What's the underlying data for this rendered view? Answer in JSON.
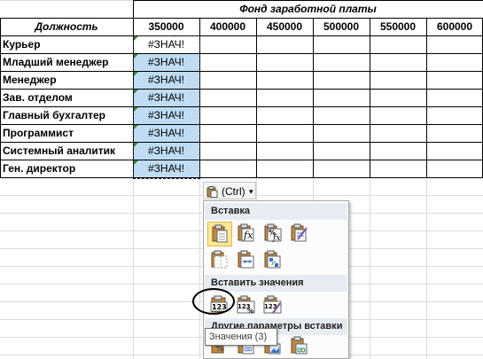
{
  "sheet": {
    "title": "Фонд заработной платы",
    "position_header": "Должность",
    "salaries": [
      "350000",
      "400000",
      "450000",
      "500000",
      "550000",
      "600000"
    ],
    "positions": [
      "Курьер",
      "Младший менеджер",
      "Менеджер",
      "Зав. отделом",
      "Главный бухгалтер",
      "Программист",
      "Системный аналитик",
      "Ген. директор"
    ],
    "error_value": "#ЗНАЧ!"
  },
  "paste_button": {
    "label": "(Ctrl)",
    "icon": "clipboard-icon",
    "arrow": "▾"
  },
  "menu": {
    "paste_section": "Вставка",
    "values_section": "Вставить значения",
    "other_section": "Другие параметры вставки",
    "paste_icons": [
      "paste-icon",
      "formulas-icon",
      "formulas-number-format-icon",
      "keep-source-formatting-icon",
      "no-borders-icon",
      "keep-column-widths-icon",
      "transpose-icon"
    ],
    "values_icons": [
      "values-icon",
      "values-number-format-icon",
      "values-source-formatting-icon"
    ],
    "other_icons": [
      "formatting-icon",
      "paste-link-icon",
      "picture-icon",
      "linked-picture-icon"
    ]
  },
  "tooltip": "Значения (3)",
  "colors": {
    "selection": "#bfdcf3",
    "highlight": "#fde89b",
    "section_header": "#e7ebf2",
    "error_indicator": "#2e8b3b"
  }
}
